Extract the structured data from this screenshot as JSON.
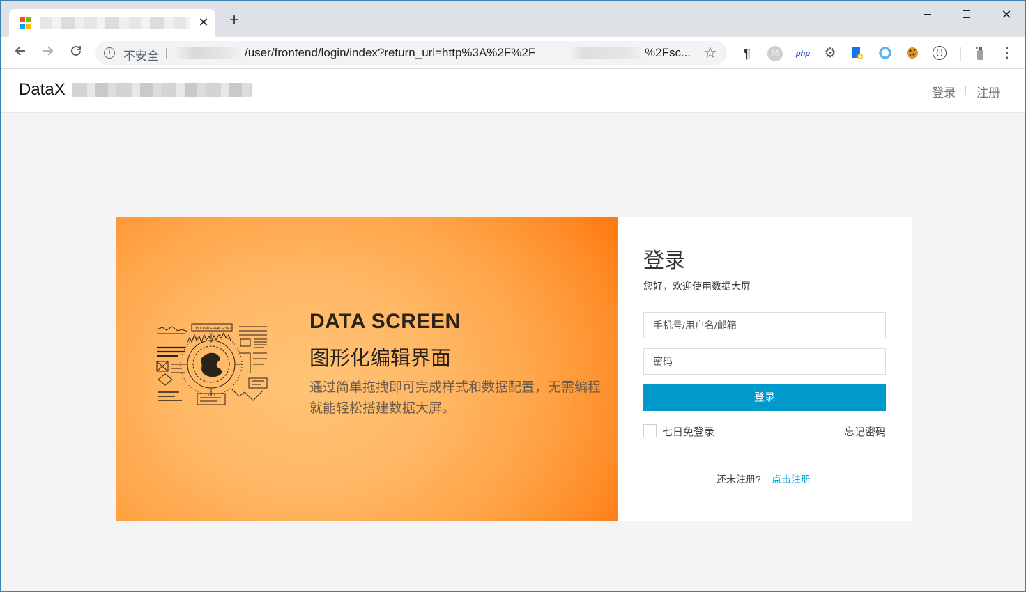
{
  "browser": {
    "new_tab_symbol": "+",
    "close_symbol": "✕",
    "security_label": "不安全",
    "separator": "|",
    "url_path": "/user/frontend/login/index?return_url=http%3A%2F%2F",
    "url_tail": "%2Fsc...",
    "extensions": [
      "paragraph-icon",
      "command-icon",
      "php-icon",
      "gear-icon",
      "file-download-icon",
      "ring-icon",
      "cookie-icon",
      "json-viewer-icon",
      "spray-icon"
    ],
    "ext_labels": {
      "php": "php",
      "json": "{·}"
    }
  },
  "header": {
    "brand": "DataX",
    "login_link": "登录",
    "register_link": "注册"
  },
  "banner": {
    "title": "DATA SCREEN",
    "subtitle": "图形化编辑界面",
    "description": "通过简单拖拽即可完成样式和数据配置，无需编程就能轻松搭建数据大屏。",
    "hud_label": "HUD INTERFACE SET"
  },
  "login": {
    "title": "登录",
    "welcome": "您好，欢迎使用数据大屏",
    "username_placeholder": "手机号/用户名/邮箱",
    "password_placeholder": "密码",
    "submit_label": "登录",
    "remember_label": "七日免登录",
    "forgot_label": "忘记密码",
    "no_account_text": "还未注册?",
    "register_cta": "点击注册"
  },
  "colors": {
    "primary_button": "#0099cc",
    "link": "#0aa0d8",
    "banner_orange": "#ff8c28"
  }
}
